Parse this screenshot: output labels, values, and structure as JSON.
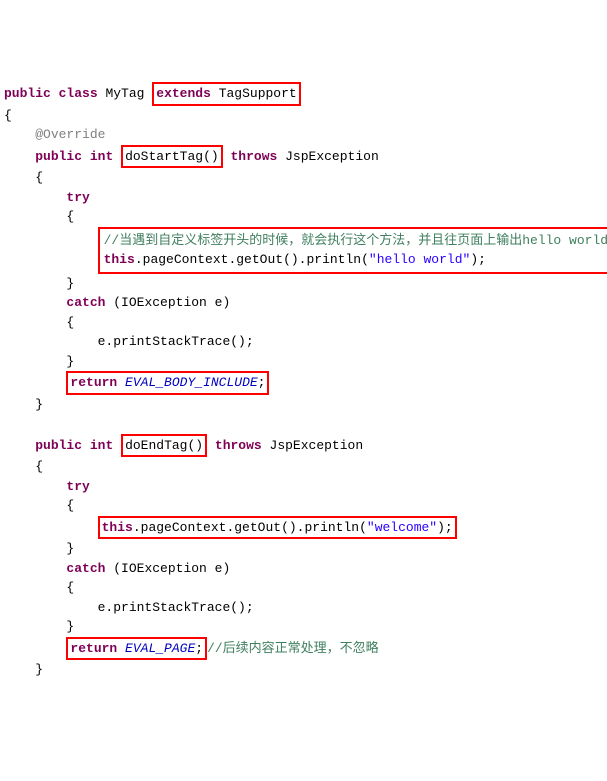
{
  "line1": {
    "public": "public",
    "class": "class",
    "className": "MyTag",
    "extends": "extends",
    "superClass": "TagSupport"
  },
  "openBrace1": "{",
  "annotation": "@Override",
  "method1": {
    "public": "public",
    "int": "int",
    "name": "doStartTag()",
    "throws": "throws",
    "exception": "JspException"
  },
  "openBrace2": "{",
  "try1": "try",
  "openBrace3": "{",
  "comment1": "//当遇到自定义标签开头的时候，就会执行这个方法，并且往页面上输出hello world",
  "stmt1": {
    "this": "this",
    "dot1": ".pageContext.getOut().println(",
    "str": "\"hello world\"",
    "end": ");"
  },
  "closeBrace3": "}",
  "catch1": {
    "catch": "catch",
    "rest": " (IOException e)"
  },
  "openBrace4": "{",
  "printStack1": "e.printStackTrace();",
  "closeBrace4": "}",
  "return1": {
    "return": "return",
    "val": "EVAL_BODY_INCLUDE",
    "semi": ";"
  },
  "closeBrace2": "}",
  "method2": {
    "public": "public",
    "int": "int",
    "name": "doEndTag()",
    "throws": "throws",
    "exception": "JspException"
  },
  "openBrace5": "{",
  "try2": "try",
  "openBrace6": "{",
  "stmt2": {
    "this": "this",
    "dot1": ".pageContext.getOut().println(",
    "str": "\"welcome\"",
    "end": ");"
  },
  "closeBrace6": "}",
  "catch2": {
    "catch": "catch",
    "rest": " (IOException e)"
  },
  "openBrace7": "{",
  "printStack2": "e.printStackTrace();",
  "closeBrace7": "}",
  "return2": {
    "return": "return",
    "val": "EVAL_PAGE",
    "semi": ";",
    "comment": "//后续内容正常处理，不忽略"
  },
  "closeBrace5": "}"
}
